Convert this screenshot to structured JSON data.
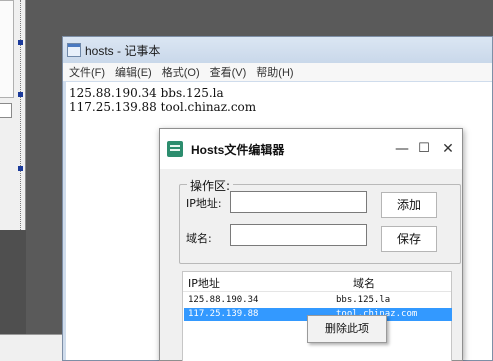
{
  "notepad": {
    "title": "hosts - 记事本",
    "menu": [
      "文件(F)",
      "编辑(E)",
      "格式(O)",
      "查看(V)",
      "帮助(H)"
    ],
    "lines": [
      "125.88.190.34 bbs.125.la",
      "117.25.139.88 tool.chinaz.com"
    ]
  },
  "dialog": {
    "title": "Hosts文件编辑器",
    "controls": {
      "minimize": "—",
      "maximize": "☐",
      "close": "✕"
    },
    "group_title": "操作区:",
    "ip_label": "IP地址:",
    "domain_label": "域名:",
    "ip_value": "",
    "domain_value": "",
    "add_button": "添加",
    "save_button": "保存",
    "list": {
      "columns": [
        "IP地址",
        "域名"
      ],
      "rows": [
        {
          "ip": "125.88.190.34",
          "domain": "bbs.125.la",
          "selected": false
        },
        {
          "ip": "117.25.139.88",
          "domain": "tool.chinaz.com",
          "selected": true
        }
      ]
    }
  },
  "context_menu": {
    "items": [
      "删除此项"
    ]
  },
  "colors": {
    "selection": "#3399ff",
    "desktop": "#5a5a5a",
    "notepad_frame": "#cfdcec"
  }
}
